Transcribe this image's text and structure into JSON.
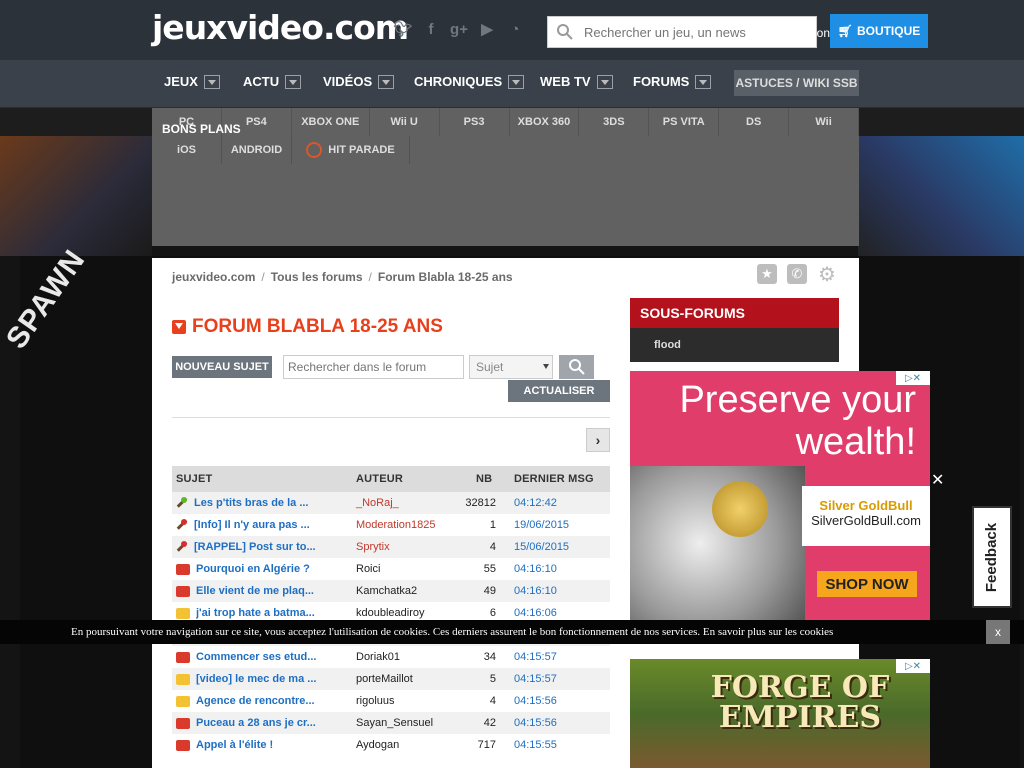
{
  "site": {
    "logo": "jeuxvideo.com",
    "search_placeholder": "Rechercher un jeu, un news",
    "connexion": "Connexion",
    "shop_label": "BOUTIQUE",
    "social": [
      "twitter-icon",
      "facebook-icon",
      "googleplus-icon",
      "youtube-icon",
      "rss-icon"
    ]
  },
  "nav": {
    "items": [
      "JEUX",
      "ACTU",
      "VIDÉOS",
      "CHRONIQUES",
      "WEB TV",
      "FORUMS"
    ],
    "astuces": "ASTUCES / WIKI SSB"
  },
  "platforms": {
    "row1": [
      "PC",
      "PS4",
      "XBOX ONE",
      "Wii U",
      "PS3",
      "XBOX 360",
      "3DS",
      "PS VITA",
      "DS",
      "Wii"
    ],
    "row2": [
      "iOS",
      "ANDROID",
      "HIT PARADE"
    ],
    "bons_plans": "BONS PLANS"
  },
  "breadcrumb": [
    "jeuxvideo.com",
    "Tous les forums",
    "Forum Blabla 18-25 ans"
  ],
  "forum": {
    "title": "FORUM BLABLA 18-25 ANS",
    "new_topic": "NOUVEAU SUJET",
    "search_placeholder": "Rechercher dans le forum",
    "search_scope": "Sujet",
    "refresh": "ACTUALISER",
    "columns": {
      "subject": "SUJET",
      "author": "AUTEUR",
      "nb": "NB",
      "last": "DERNIER MSG"
    },
    "topics": [
      {
        "icon": "pin-green",
        "subject": "Les p'tits bras de la ...",
        "author": "_NoRaj_",
        "nb": "32812",
        "last": "04:12:42",
        "author_color": "#c0392b"
      },
      {
        "icon": "pin-red",
        "subject": "[Info] Il n'y aura pas ...",
        "author": "Moderation1825",
        "nb": "1",
        "last": "19/06/2015",
        "author_color": "#c0392b"
      },
      {
        "icon": "pin-red",
        "subject": "[RAPPEL] Post sur to...",
        "author": "Sprytix",
        "nb": "4",
        "last": "15/06/2015",
        "author_color": "#c0392b"
      },
      {
        "icon": "folder-red",
        "subject": "Pourquoi en Algérie ?",
        "author": "Roici",
        "nb": "55",
        "last": "04:16:10",
        "author_color": "#222"
      },
      {
        "icon": "folder-red",
        "subject": "Elle vient de me plaq...",
        "author": "Kamchatka2",
        "nb": "49",
        "last": "04:16:10",
        "author_color": "#222"
      },
      {
        "icon": "folder-yellow",
        "subject": "j'ai trop hate a batma...",
        "author": "kdoubleadiroy",
        "nb": "6",
        "last": "04:16:06",
        "author_color": "#222"
      },
      {
        "icon": "folder-red",
        "subject": "",
        "author": "",
        "nb": "",
        "last": "",
        "author_color": "#222"
      },
      {
        "icon": "folder-red",
        "subject": "Commencer ses etud...",
        "author": "Doriak01",
        "nb": "34",
        "last": "04:15:57",
        "author_color": "#222"
      },
      {
        "icon": "folder-yellow",
        "subject": "[video] le mec de ma ...",
        "author": "porteMaillot",
        "nb": "5",
        "last": "04:15:57",
        "author_color": "#222"
      },
      {
        "icon": "folder-yellow",
        "subject": "Agence de rencontre...",
        "author": "rigoluus",
        "nb": "4",
        "last": "04:15:56",
        "author_color": "#222"
      },
      {
        "icon": "folder-red",
        "subject": "Puceau a 28 ans je cr...",
        "author": "Sayan_Sensuel",
        "nb": "42",
        "last": "04:15:56",
        "author_color": "#222"
      },
      {
        "icon": "folder-red",
        "subject": "Appel à l'élite !",
        "author": "Aydogan",
        "nb": "717",
        "last": "04:15:55",
        "author_color": "#222"
      }
    ]
  },
  "sidebar": {
    "title": "SOUS-FORUMS",
    "items": [
      "flood"
    ]
  },
  "ads": {
    "ad1_text": "Preserve your wealth!",
    "ad1_brand": "SilverGoldBull.com",
    "ad1_brand_name": "Silver GoldBull",
    "ad1_cta": "SHOP NOW",
    "ad2_text": "FORGE OF EMPIRES"
  },
  "feedback": "Feedback",
  "cookie": {
    "text": "En poursuivant votre navigation sur ce site, vous acceptez l'utilisation de cookies. Ces derniers assurent le bon fonctionnement de nos services. En savoir plus sur les cookies",
    "close": "x"
  },
  "background": {
    "left_word": "SPAWN"
  }
}
